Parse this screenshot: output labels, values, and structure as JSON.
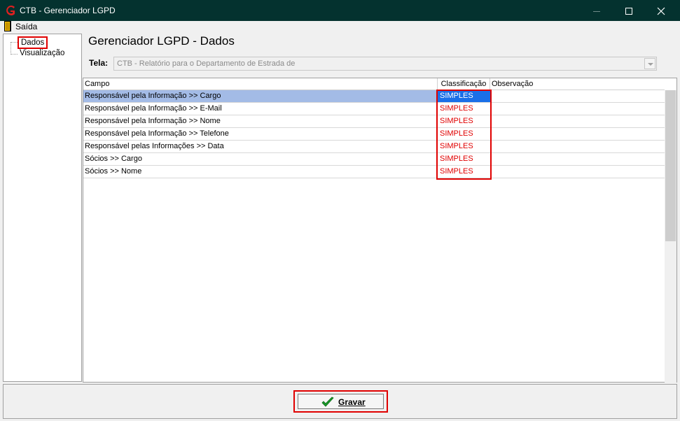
{
  "window": {
    "title": "CTB - Gerenciador LGPD",
    "logo_icon": "ctb-logo-icon"
  },
  "menu": {
    "exit_label": "Saída",
    "exit_icon": "exit-door-icon"
  },
  "tree": {
    "items": [
      {
        "label": "Dados",
        "selected": true
      },
      {
        "label": "Visualização",
        "selected": false
      }
    ]
  },
  "main": {
    "title": "Gerenciador LGPD - Dados",
    "tela_label": "Tela:",
    "tela_value": "CTB - Relatório para o Departamento de Estrada de"
  },
  "grid": {
    "columns": [
      "Campo",
      "Classificação",
      "Observação"
    ],
    "rows": [
      {
        "campo": "Responsável pela Informação >> Cargo",
        "classificacao": "SIMPLES",
        "observacao": ""
      },
      {
        "campo": "Responsável pela Informação >> E-Mail",
        "classificacao": "SIMPLES",
        "observacao": ""
      },
      {
        "campo": "Responsável pela Informação >> Nome",
        "classificacao": "SIMPLES",
        "observacao": ""
      },
      {
        "campo": "Responsável pela Informação >> Telefone",
        "classificacao": "SIMPLES",
        "observacao": ""
      },
      {
        "campo": "Responsável pelas Informações >> Data",
        "classificacao": "SIMPLES",
        "observacao": ""
      },
      {
        "campo": "Sócios >> Cargo",
        "classificacao": "SIMPLES",
        "observacao": ""
      },
      {
        "campo": "Sócios >> Nome",
        "classificacao": "SIMPLES",
        "observacao": ""
      }
    ]
  },
  "footer": {
    "gravar_label": "Gravar",
    "gravar_icon": "checkmark-icon"
  },
  "colors": {
    "titlebar": "#04322f",
    "highlight_red": "#e00000",
    "selected_row": "#a3bbe6",
    "selected_cell": "#1a6fe8"
  }
}
